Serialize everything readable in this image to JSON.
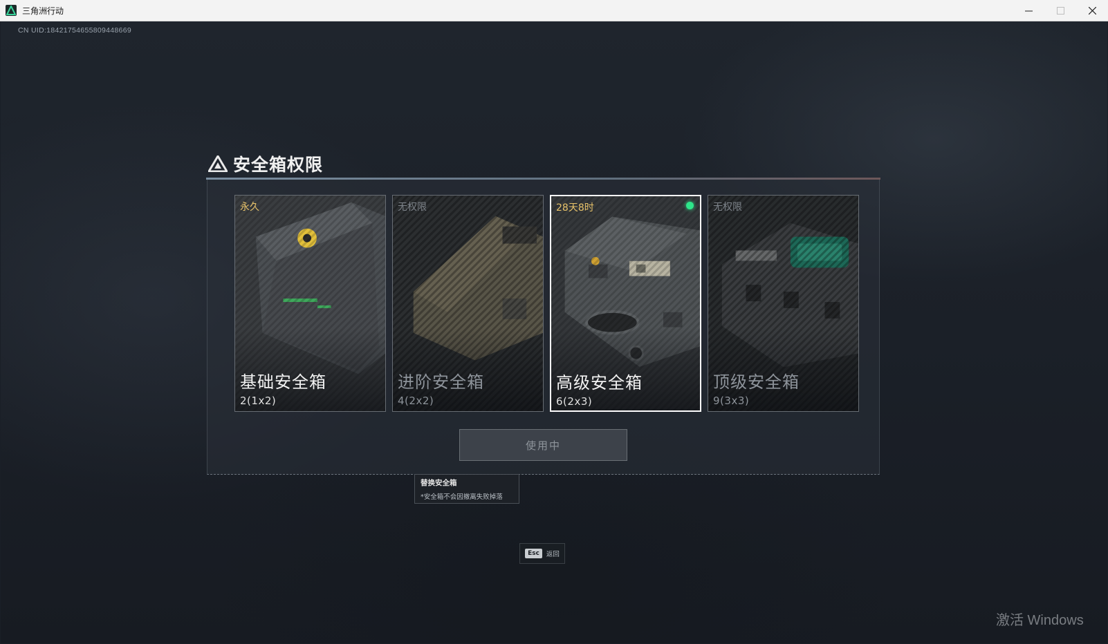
{
  "window": {
    "title": "三角洲行动",
    "minimize_icon": "minimize-icon",
    "maximize_icon": "maximize-icon",
    "close_icon": "close-icon"
  },
  "game": {
    "uid": "CN UID:1842175465580944866​9"
  },
  "dialog": {
    "title": "安全箱权限",
    "title_icon": "delta-triangle-icon",
    "cards": [
      {
        "status": "永久",
        "name": "基础安全箱",
        "capacity": "2(1x2)",
        "state": "owned"
      },
      {
        "status": "无权限",
        "name": "进阶安全箱",
        "capacity": "4(2x2)",
        "state": "locked"
      },
      {
        "status": "28天8时",
        "name": "高级安全箱",
        "capacity": "6(2x3)",
        "state": "selected-active"
      },
      {
        "status": "无权限",
        "name": "顶级安全箱",
        "capacity": "9(3x3)",
        "state": "locked"
      }
    ],
    "use_button": "使用中",
    "tooltip": {
      "title": "替换安全箱",
      "note": "*安全箱不会因撤离失败掉落"
    }
  },
  "footer": {
    "esc_key": "Esc",
    "esc_label": "返回"
  },
  "watermark": "激活 Windows",
  "colors": {
    "status_owned": "#e8c36a",
    "active_dot": "#2ee58a",
    "locked_text": "#7d838a"
  }
}
